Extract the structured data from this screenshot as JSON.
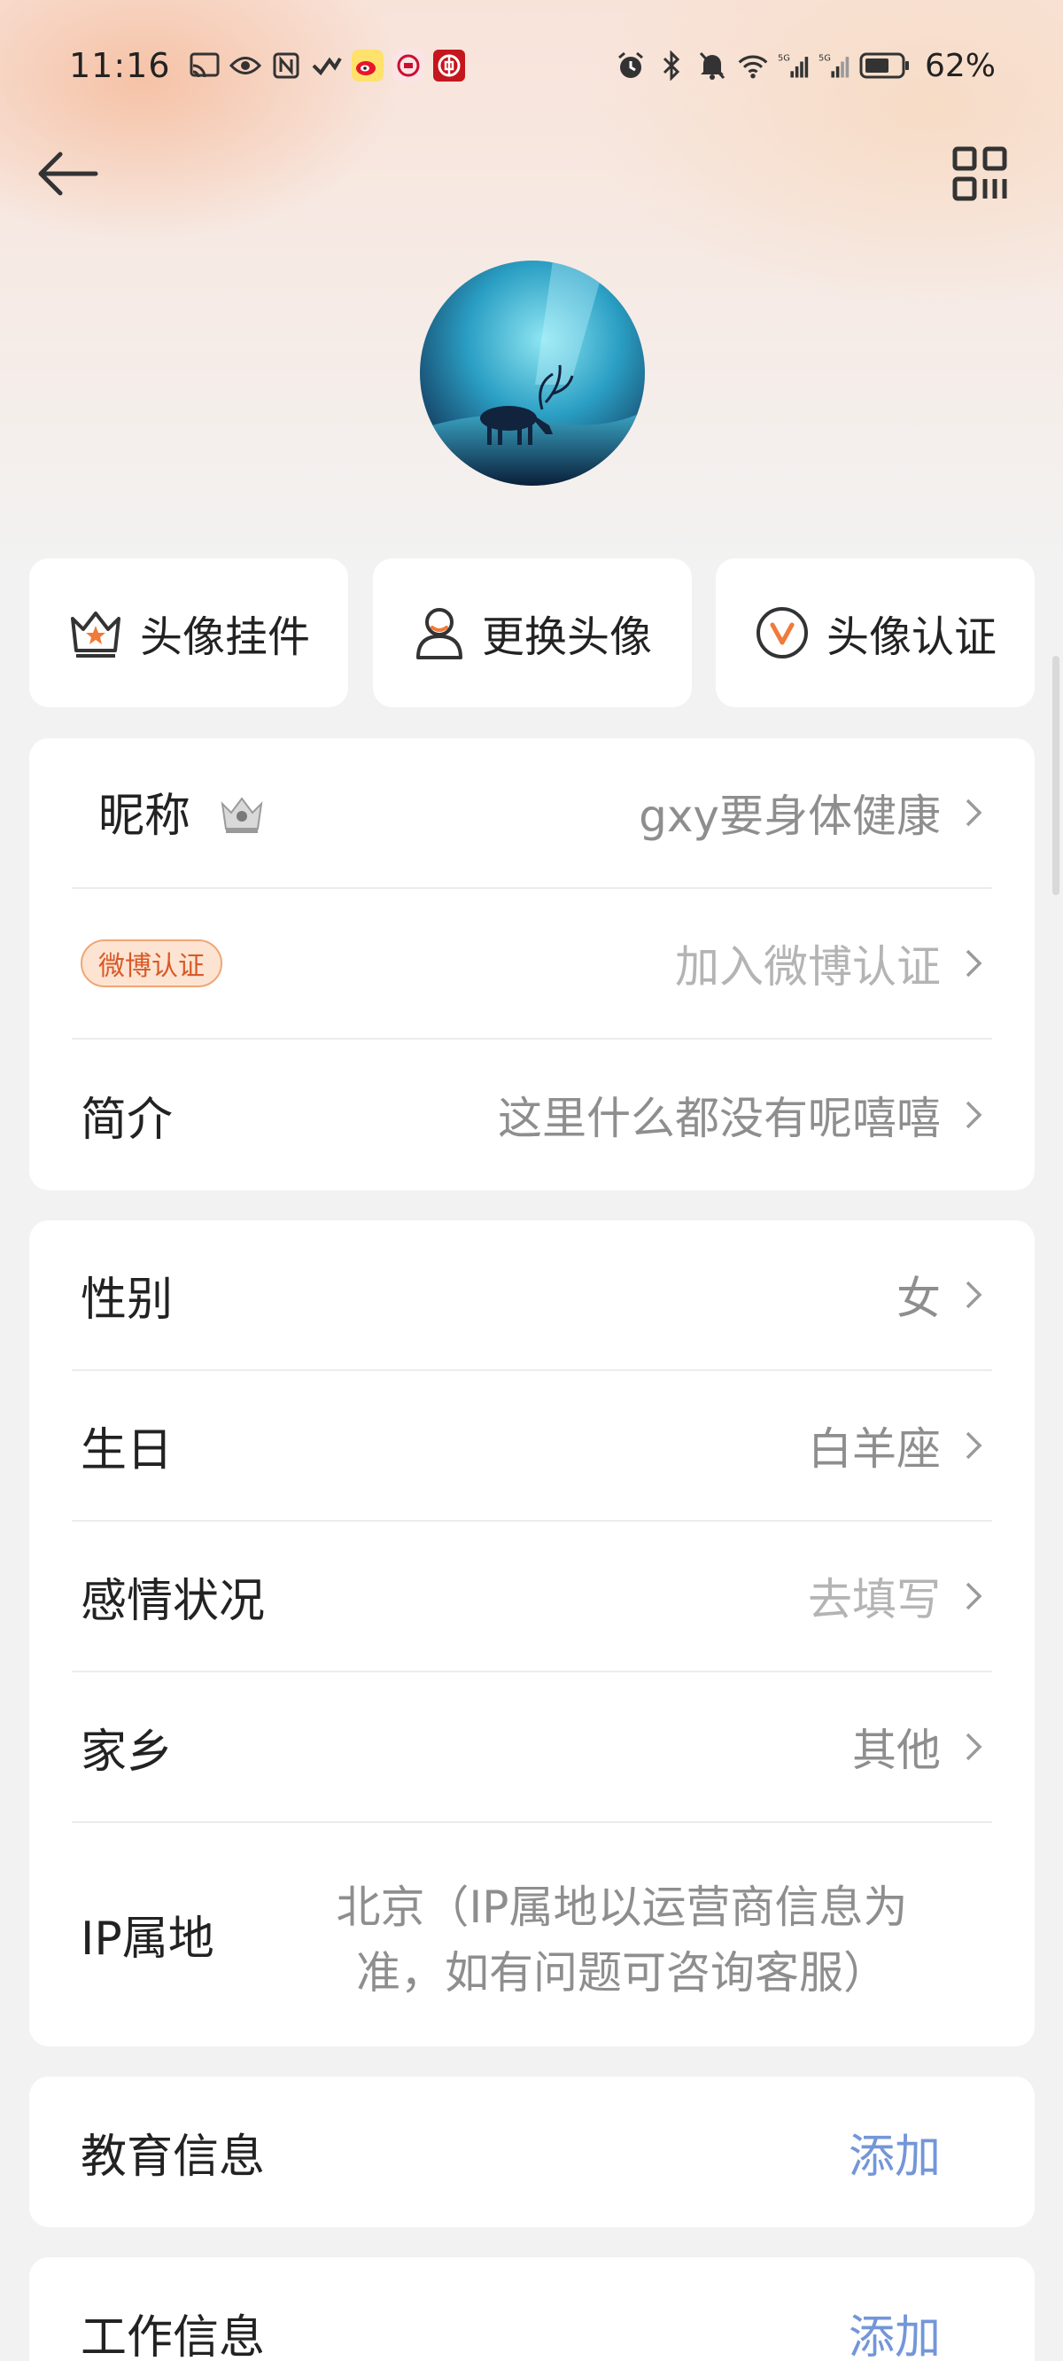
{
  "status_bar": {
    "time": "11:16",
    "battery": "62%",
    "network_label": "5G"
  },
  "avatar_actions": [
    {
      "label": "头像挂件"
    },
    {
      "label": "更换头像"
    },
    {
      "label": "头像认证"
    }
  ],
  "profile": {
    "nickname_label": "昵称",
    "nickname_value": "gxy要身体健康",
    "weibo_badge": "微博认证",
    "weibo_value": "加入微博认证",
    "bio_label": "简介",
    "bio_value": "这里什么都没有呢嘻嘻"
  },
  "details": {
    "gender_label": "性别",
    "gender_value": "女",
    "birthday_label": "生日",
    "birthday_value": "白羊座",
    "relationship_label": "感情状况",
    "relationship_value": "去填写",
    "hometown_label": "家乡",
    "hometown_value": "其他",
    "ip_label": "IP属地",
    "ip_value": "北京（IP属地以运营商信息为准，如有问题可咨询客服）"
  },
  "education": {
    "label": "教育信息",
    "action": "添加"
  },
  "work": {
    "label": "工作信息",
    "action": "添加"
  },
  "colors": {
    "accent_orange": "#f07a3a",
    "link_blue": "#7396d8"
  }
}
